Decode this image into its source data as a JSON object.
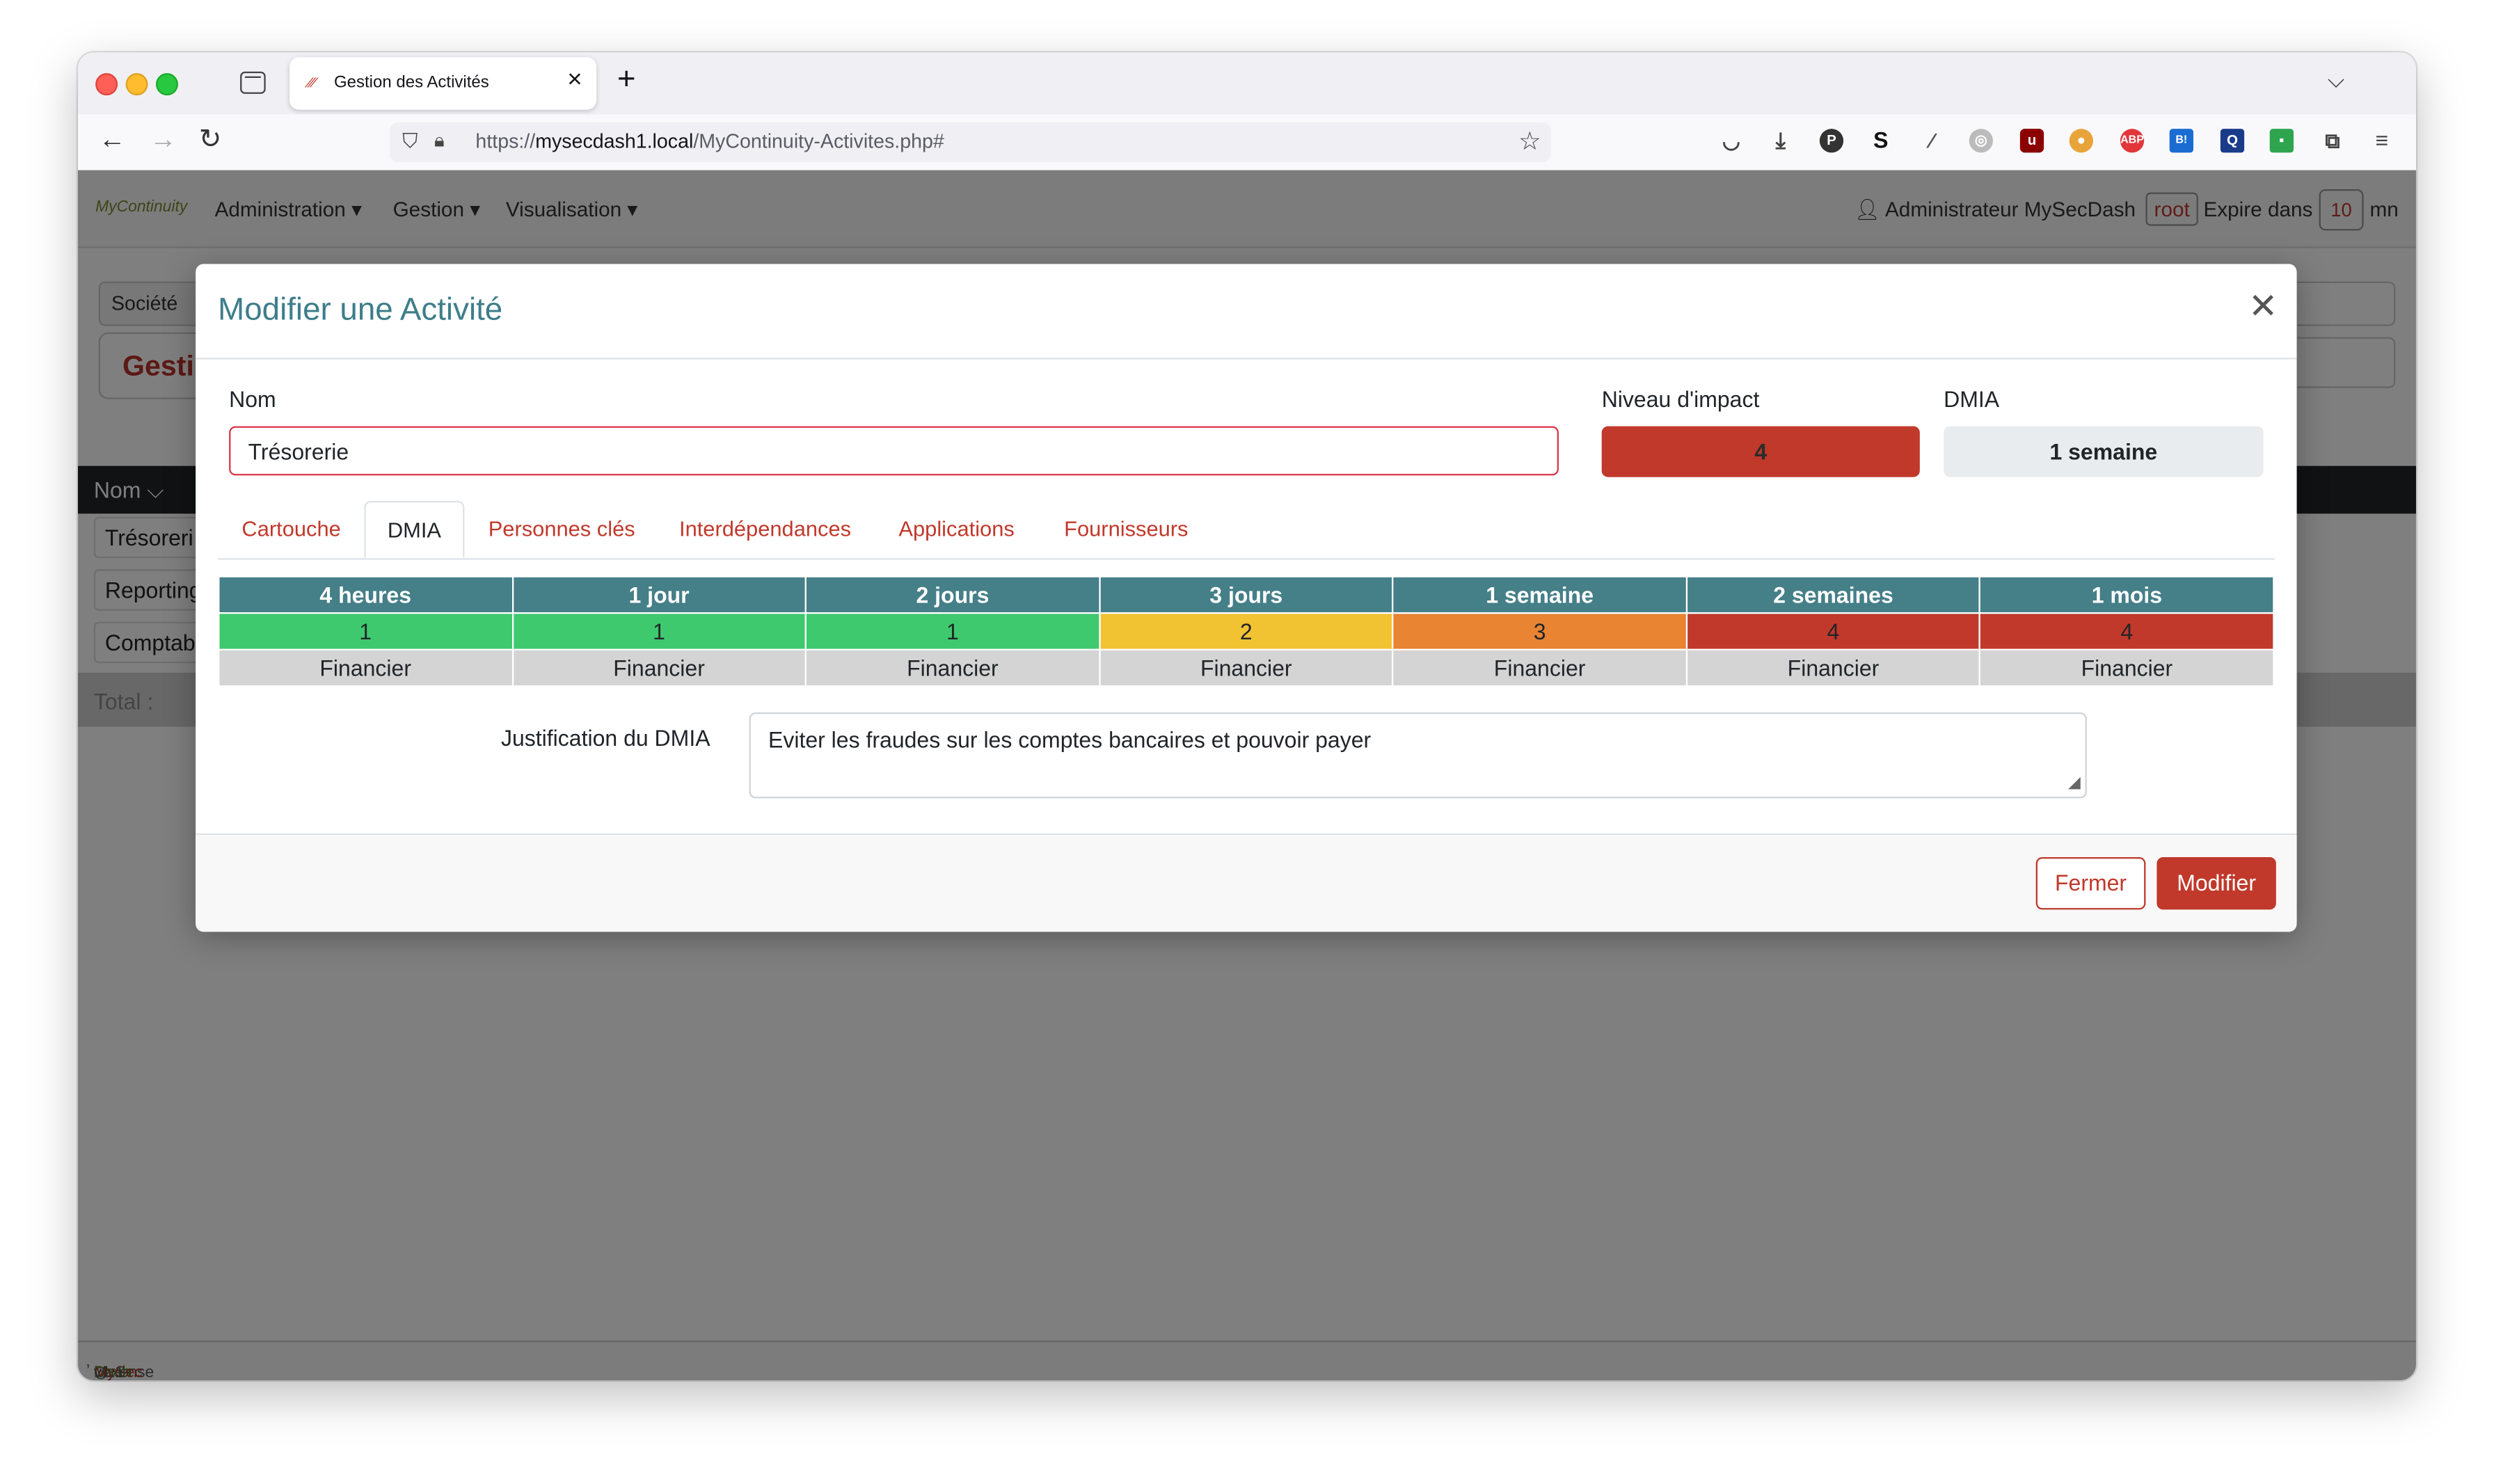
{
  "browser": {
    "tab_title": "Gestion des Activités",
    "url_prefix": "https://",
    "url_host": "mysecdash1.local",
    "url_path": "/MyContinuity-Activites.php#"
  },
  "page": {
    "logo": "MyContinuity",
    "menu": [
      "Administration ▾",
      "Gestion ▾",
      "Visualisation ▾"
    ],
    "user": "Administrateur MySecDash",
    "user_badge": "root",
    "expire_label": "Expire dans",
    "expire_minutes": "10",
    "expire_unit": "mn",
    "societe_label": "Société",
    "heading_partial": "Gesti",
    "column_nom": "Nom ⌵",
    "rows": [
      "Trésoreri",
      "Reporting",
      "Comptab"
    ],
    "total_label": "Total :",
    "footer_prefix": "Loxense ",
    "footer_brand_a": "MySec",
    "footer_brand_b": "Dash",
    "footer_version": " v1.1-2"
  },
  "modal": {
    "title": "Modifier une Activité",
    "nom_label": "Nom",
    "nom_value": "Trésorerie",
    "impact_label": "Niveau d'impact",
    "impact_value": "4",
    "dmia_label": "DMIA",
    "dmia_value": "1 semaine",
    "tabs": [
      "Cartouche",
      "DMIA",
      "Personnes clés",
      "Interdépendances",
      "Applications",
      "Fournisseurs"
    ],
    "active_tab": "DMIA",
    "dmia_table": {
      "headers": [
        "4 heures",
        "1 jour",
        "2 jours",
        "3 jours",
        "1 semaine",
        "2 semaines",
        "1 mois"
      ],
      "levels": [
        "1",
        "1",
        "1",
        "2",
        "3",
        "4",
        "4"
      ],
      "level_colors": [
        "#3ec96e",
        "#3ec96e",
        "#3ec96e",
        "#f1c232",
        "#e88432",
        "#c0392b",
        "#c0392b"
      ],
      "categories": [
        "Financier",
        "Financier",
        "Financier",
        "Financier",
        "Financier",
        "Financier",
        "Financier"
      ]
    },
    "justification_label": "Justification du DMIA",
    "justification_value": "Eviter les fraudes sur les comptes bancaires et pouvoir payer",
    "btn_close": "Fermer",
    "btn_submit": "Modifier"
  },
  "colors": {
    "accent": "#c0392b",
    "title": "#3e7d8a",
    "table_header": "#457f88"
  }
}
